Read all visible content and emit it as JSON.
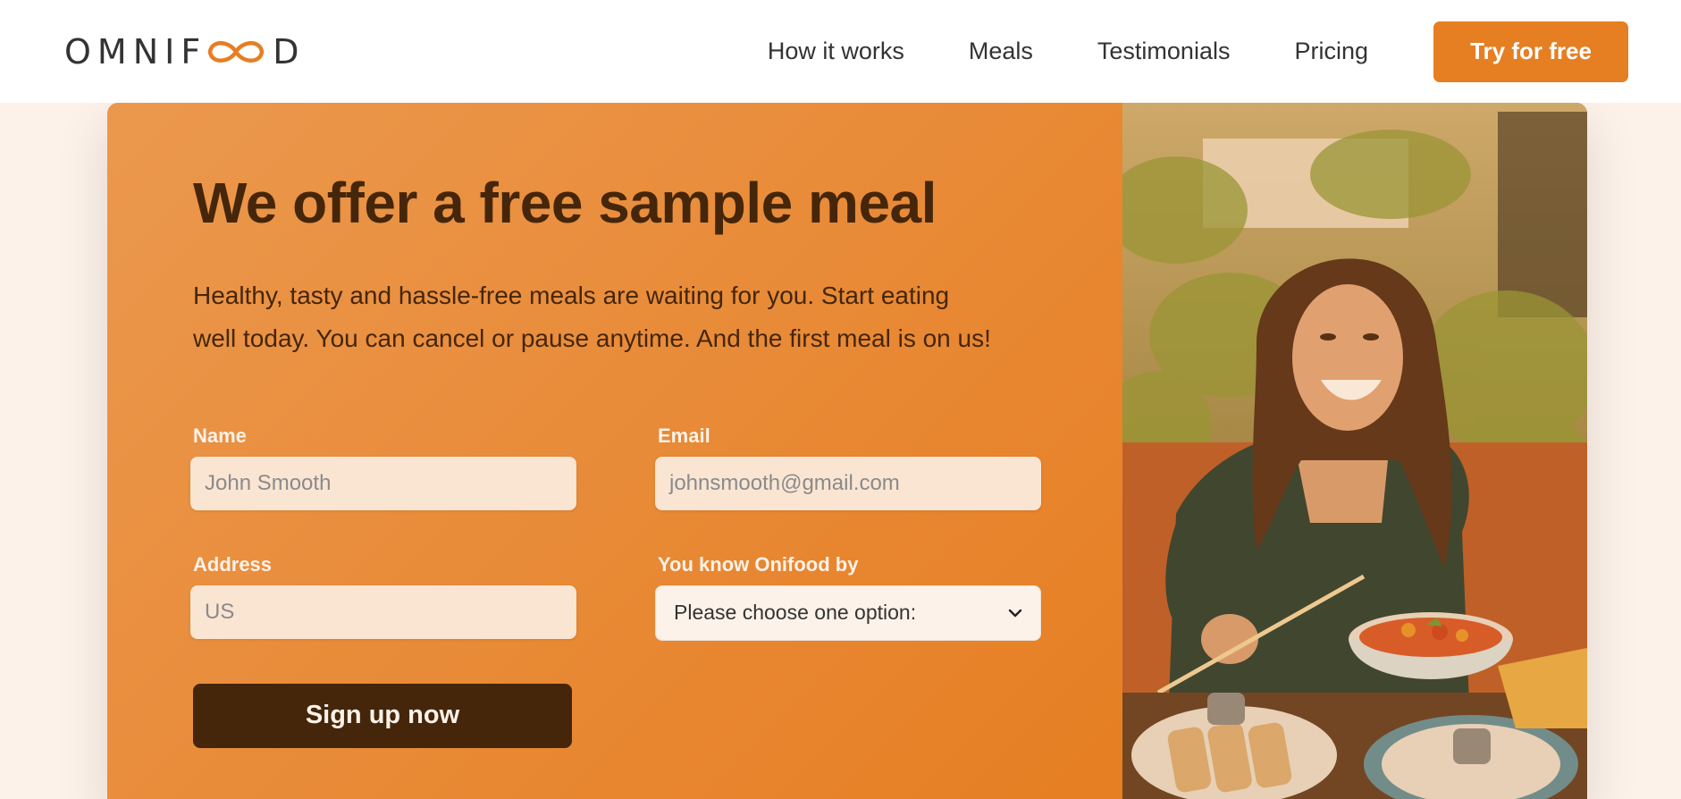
{
  "header": {
    "logo_text_left": "OMNIF",
    "logo_text_right": "D",
    "nav": [
      "How it works",
      "Meals",
      "Testimonials",
      "Pricing"
    ],
    "cta_label": "Try for free"
  },
  "cta": {
    "heading": "We offer a free sample meal",
    "description": "Healthy, tasty and hassle-free meals are waiting for you. Start eating well today. You can cancel or pause anytime. And the first meal is on us!",
    "form": {
      "name_label": "Name",
      "name_placeholder": "John Smooth",
      "email_label": "Email",
      "email_placeholder": "johnsmooth@gmail.com",
      "address_label": "Address",
      "address_placeholder": "US",
      "source_label": "You know Onifood by",
      "source_selected": "Please choose one option:",
      "submit_label": "Sign up now"
    }
  },
  "colors": {
    "accent": "#e67e22",
    "dark_brown": "#45260a",
    "input_bg": "#fae5d3"
  },
  "icons": {
    "logo": "infinity-icon",
    "select": "chevron-down-icon"
  }
}
